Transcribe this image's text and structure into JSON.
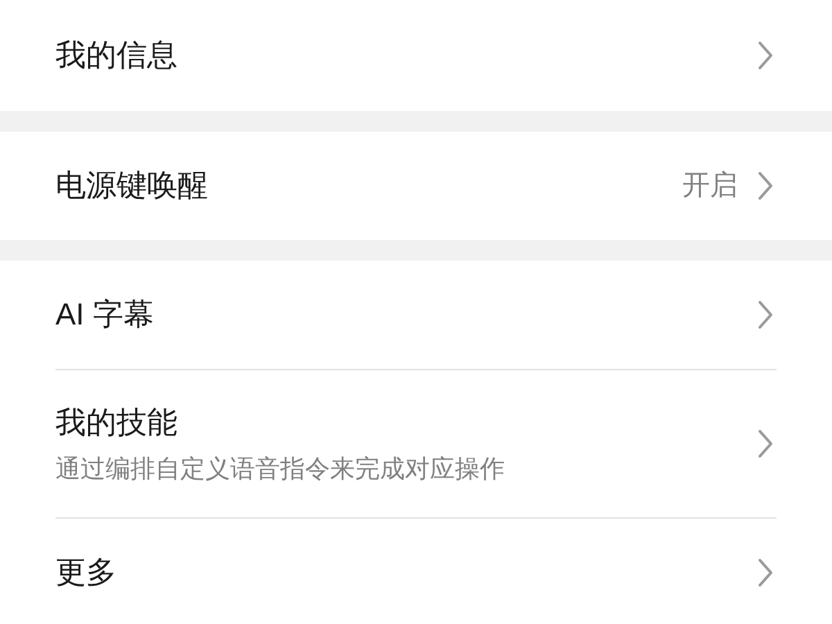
{
  "groups": [
    {
      "items": [
        {
          "title": "我的信息"
        }
      ]
    },
    {
      "items": [
        {
          "title": "电源键唤醒",
          "value": "开启"
        }
      ]
    },
    {
      "items": [
        {
          "title": "AI 字幕"
        },
        {
          "title": "我的技能",
          "subtitle": "通过编排自定义语音指令来完成对应操作"
        },
        {
          "title": "更多"
        }
      ]
    }
  ]
}
